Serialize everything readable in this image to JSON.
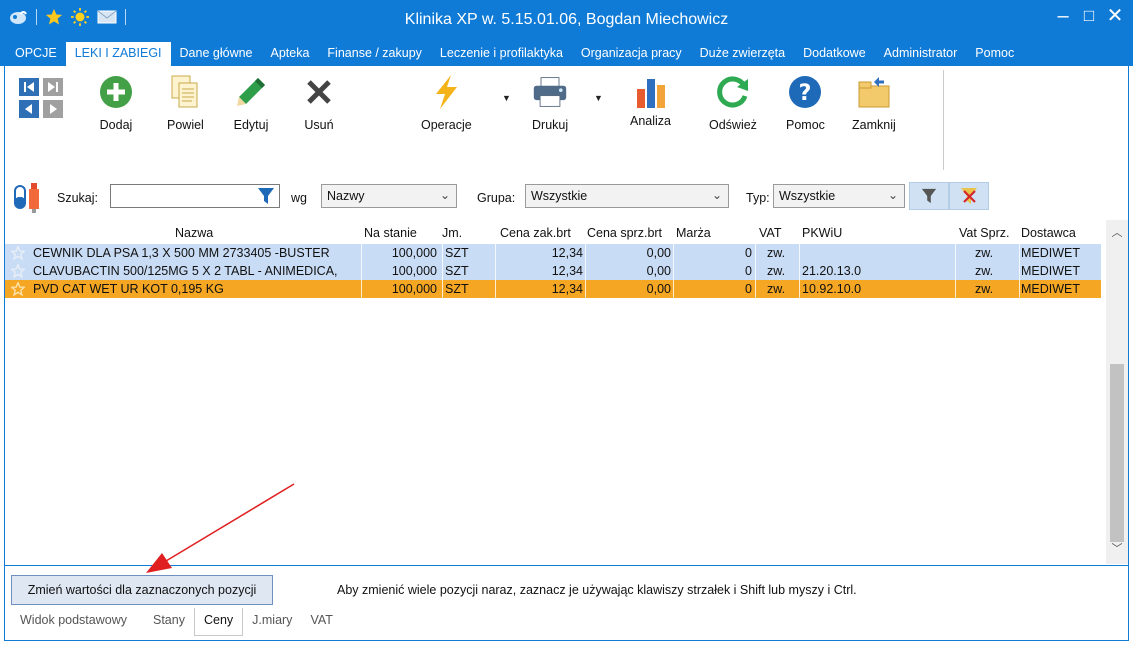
{
  "window": {
    "title": "Klinika XP w. 5.15.01.06, Bogdan Miechowicz",
    "controls": [
      "–",
      "□",
      "✕"
    ]
  },
  "menu": {
    "tabs": [
      "OPCJE",
      "LEKI I ZABIEGI",
      "Dane główne",
      "Apteka",
      "Finanse / zakupy",
      "Leczenie i profilaktyka",
      "Organizacja pracy",
      "Duże zwierzęta",
      "Dodatkowe",
      "Administrator",
      "Pomoc"
    ],
    "active": "LEKI I ZABIEGI"
  },
  "ribbon": {
    "dodaj": "Dodaj",
    "powiel": "Powiel",
    "edytuj": "Edytuj",
    "usun": "Usuń",
    "operacje": "Operacje",
    "drukuj": "Drukuj",
    "analiza": "Analiza",
    "odswiez": "Odśwież",
    "pomoc": "Pomoc",
    "zamknij": "Zamknij"
  },
  "search": {
    "szukaj_label": "Szukaj:",
    "szukaj_value": "",
    "wg_label": "wg",
    "wg_value": "Nazwy",
    "grupa_label": "Grupa:",
    "grupa_value": "Wszystkie",
    "typ_label": "Typ:",
    "typ_value": "Wszystkie"
  },
  "table": {
    "headers": {
      "nazwa": "Nazwa",
      "na_stanie": "Na stanie",
      "jm": "Jm.",
      "cena_zak": "Cena zak.brt",
      "cena_sprz": "Cena sprz.brt",
      "marza": "Marża",
      "vat": "VAT",
      "pkwiu": "PKWiU",
      "vat_sprz": "Vat Sprz.",
      "dostawca": "Dostawca"
    },
    "rows": [
      {
        "nazwa": "CEWNIK DLA PSA 1,3 X 500 MM   2733405 -BUSTER",
        "na_stanie": "100,000",
        "jm": "SZT",
        "cena_zak": "12,34",
        "cena_sprz": "0,00",
        "marza": "0",
        "vat": "zw.",
        "pkwiu": "",
        "vat_sprz": "zw.",
        "dostawca": "MEDIWET"
      },
      {
        "nazwa": "CLAVUBACTIN 500/125MG  5 X 2 TABL - ANIMEDICA,",
        "na_stanie": "100,000",
        "jm": "SZT",
        "cena_zak": "12,34",
        "cena_sprz": "0,00",
        "marza": "0",
        "vat": "zw.",
        "pkwiu": "21.20.13.0",
        "vat_sprz": "zw.",
        "dostawca": "MEDIWET"
      },
      {
        "nazwa": "PVD CAT WET UR KOT 0,195 KG",
        "na_stanie": "100,000",
        "jm": "SZT",
        "cena_zak": "12,34",
        "cena_sprz": "0,00",
        "marza": "0",
        "vat": "zw.",
        "pkwiu": "10.92.10.0",
        "vat_sprz": "zw.",
        "dostawca": "MEDIWET"
      }
    ]
  },
  "bottom": {
    "change_button": "Zmień wartości dla zaznaczonych pozycji",
    "hint": "Aby zmienić wiele pozycji naraz, zaznacz je używając klawiszy strzałek i Shift lub myszy i Ctrl.",
    "subtabs": [
      "Widok podstawowy",
      "Stany",
      "Ceny",
      "J.miary",
      "VAT"
    ],
    "active_subtab": "Ceny"
  },
  "colors": {
    "accent": "#0f7bd6",
    "selected_row": "#c9dcf5",
    "focused_row": "#f5a623",
    "annotation_arrow": "#e02020"
  }
}
